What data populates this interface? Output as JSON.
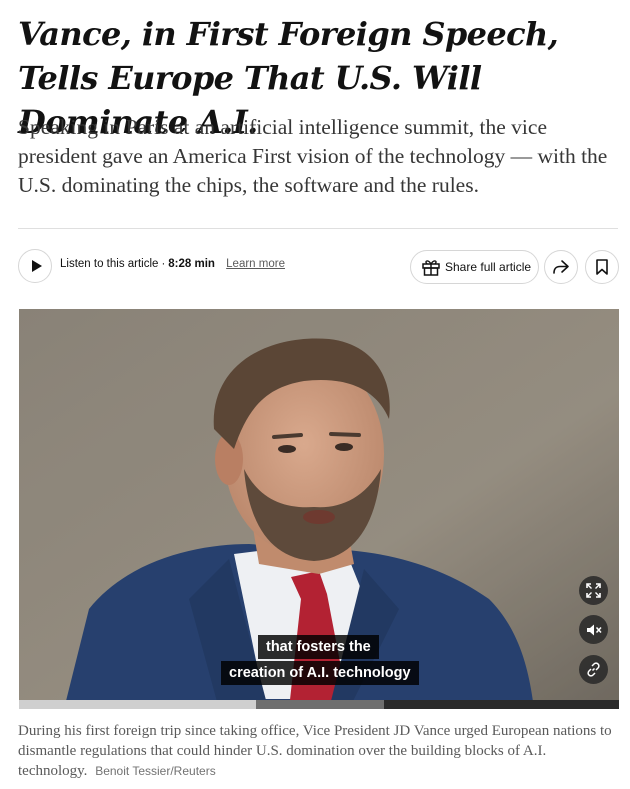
{
  "article": {
    "headline": "Vance, in First Foreign Speech, Tells Europe That U.S. Will Dominate A.I.",
    "summary": "Speaking in Paris at an artificial intelligence summit, the vice president gave an America First vision of the technology — with the U.S. dominating the chips, the software and the rules."
  },
  "toolbar": {
    "listen_label": "Listen to this article",
    "separator": "·",
    "duration": "8:28 min",
    "learn_more": "Learn more",
    "share_label": "Share full article",
    "icons": [
      "play-icon",
      "gift-icon",
      "share-arrow-icon",
      "bookmark-icon"
    ]
  },
  "video": {
    "subtitle_line1": "that fosters the",
    "subtitle_line2": "creation of A.I. technology",
    "progress_played": 0.395,
    "progress_buffered": 0.608,
    "controls": [
      "fullscreen-icon",
      "mute-icon",
      "link-icon"
    ]
  },
  "photo": {
    "caption": "During his first foreign trip since taking office, Vice President JD Vance urged European nations to dismantle regulations that could hinder U.S. domination over the building blocks of A.I. technology.",
    "credit": "Benoit Tessier/Reuters"
  },
  "colors": {
    "text": "#121212",
    "secondary_text": "#5a5a5a",
    "border": "#d6d6d6",
    "suit_blue": "#27406e",
    "tie_red": "#b32233"
  }
}
